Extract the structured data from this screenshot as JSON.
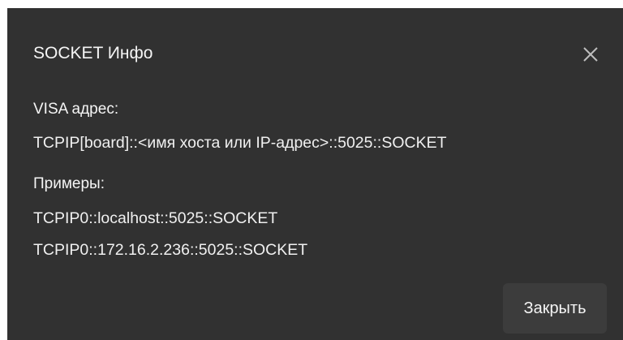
{
  "dialog": {
    "title": "SOCKET Инфо",
    "close_icon": "close-icon",
    "visa_label": "VISA адрес:",
    "visa_value": "TCPIP[board]::<имя хоста или IP-адрес>::5025::SOCKET",
    "examples_label": "Примеры:",
    "examples": [
      "TCPIP0::localhost::5025::SOCKET",
      "TCPIP0::172.16.2.236::5025::SOCKET"
    ],
    "close_button_label": "Закрыть"
  },
  "colors": {
    "background": "#313131",
    "text": "#f0f0f0",
    "button": "#3c3c3c"
  }
}
